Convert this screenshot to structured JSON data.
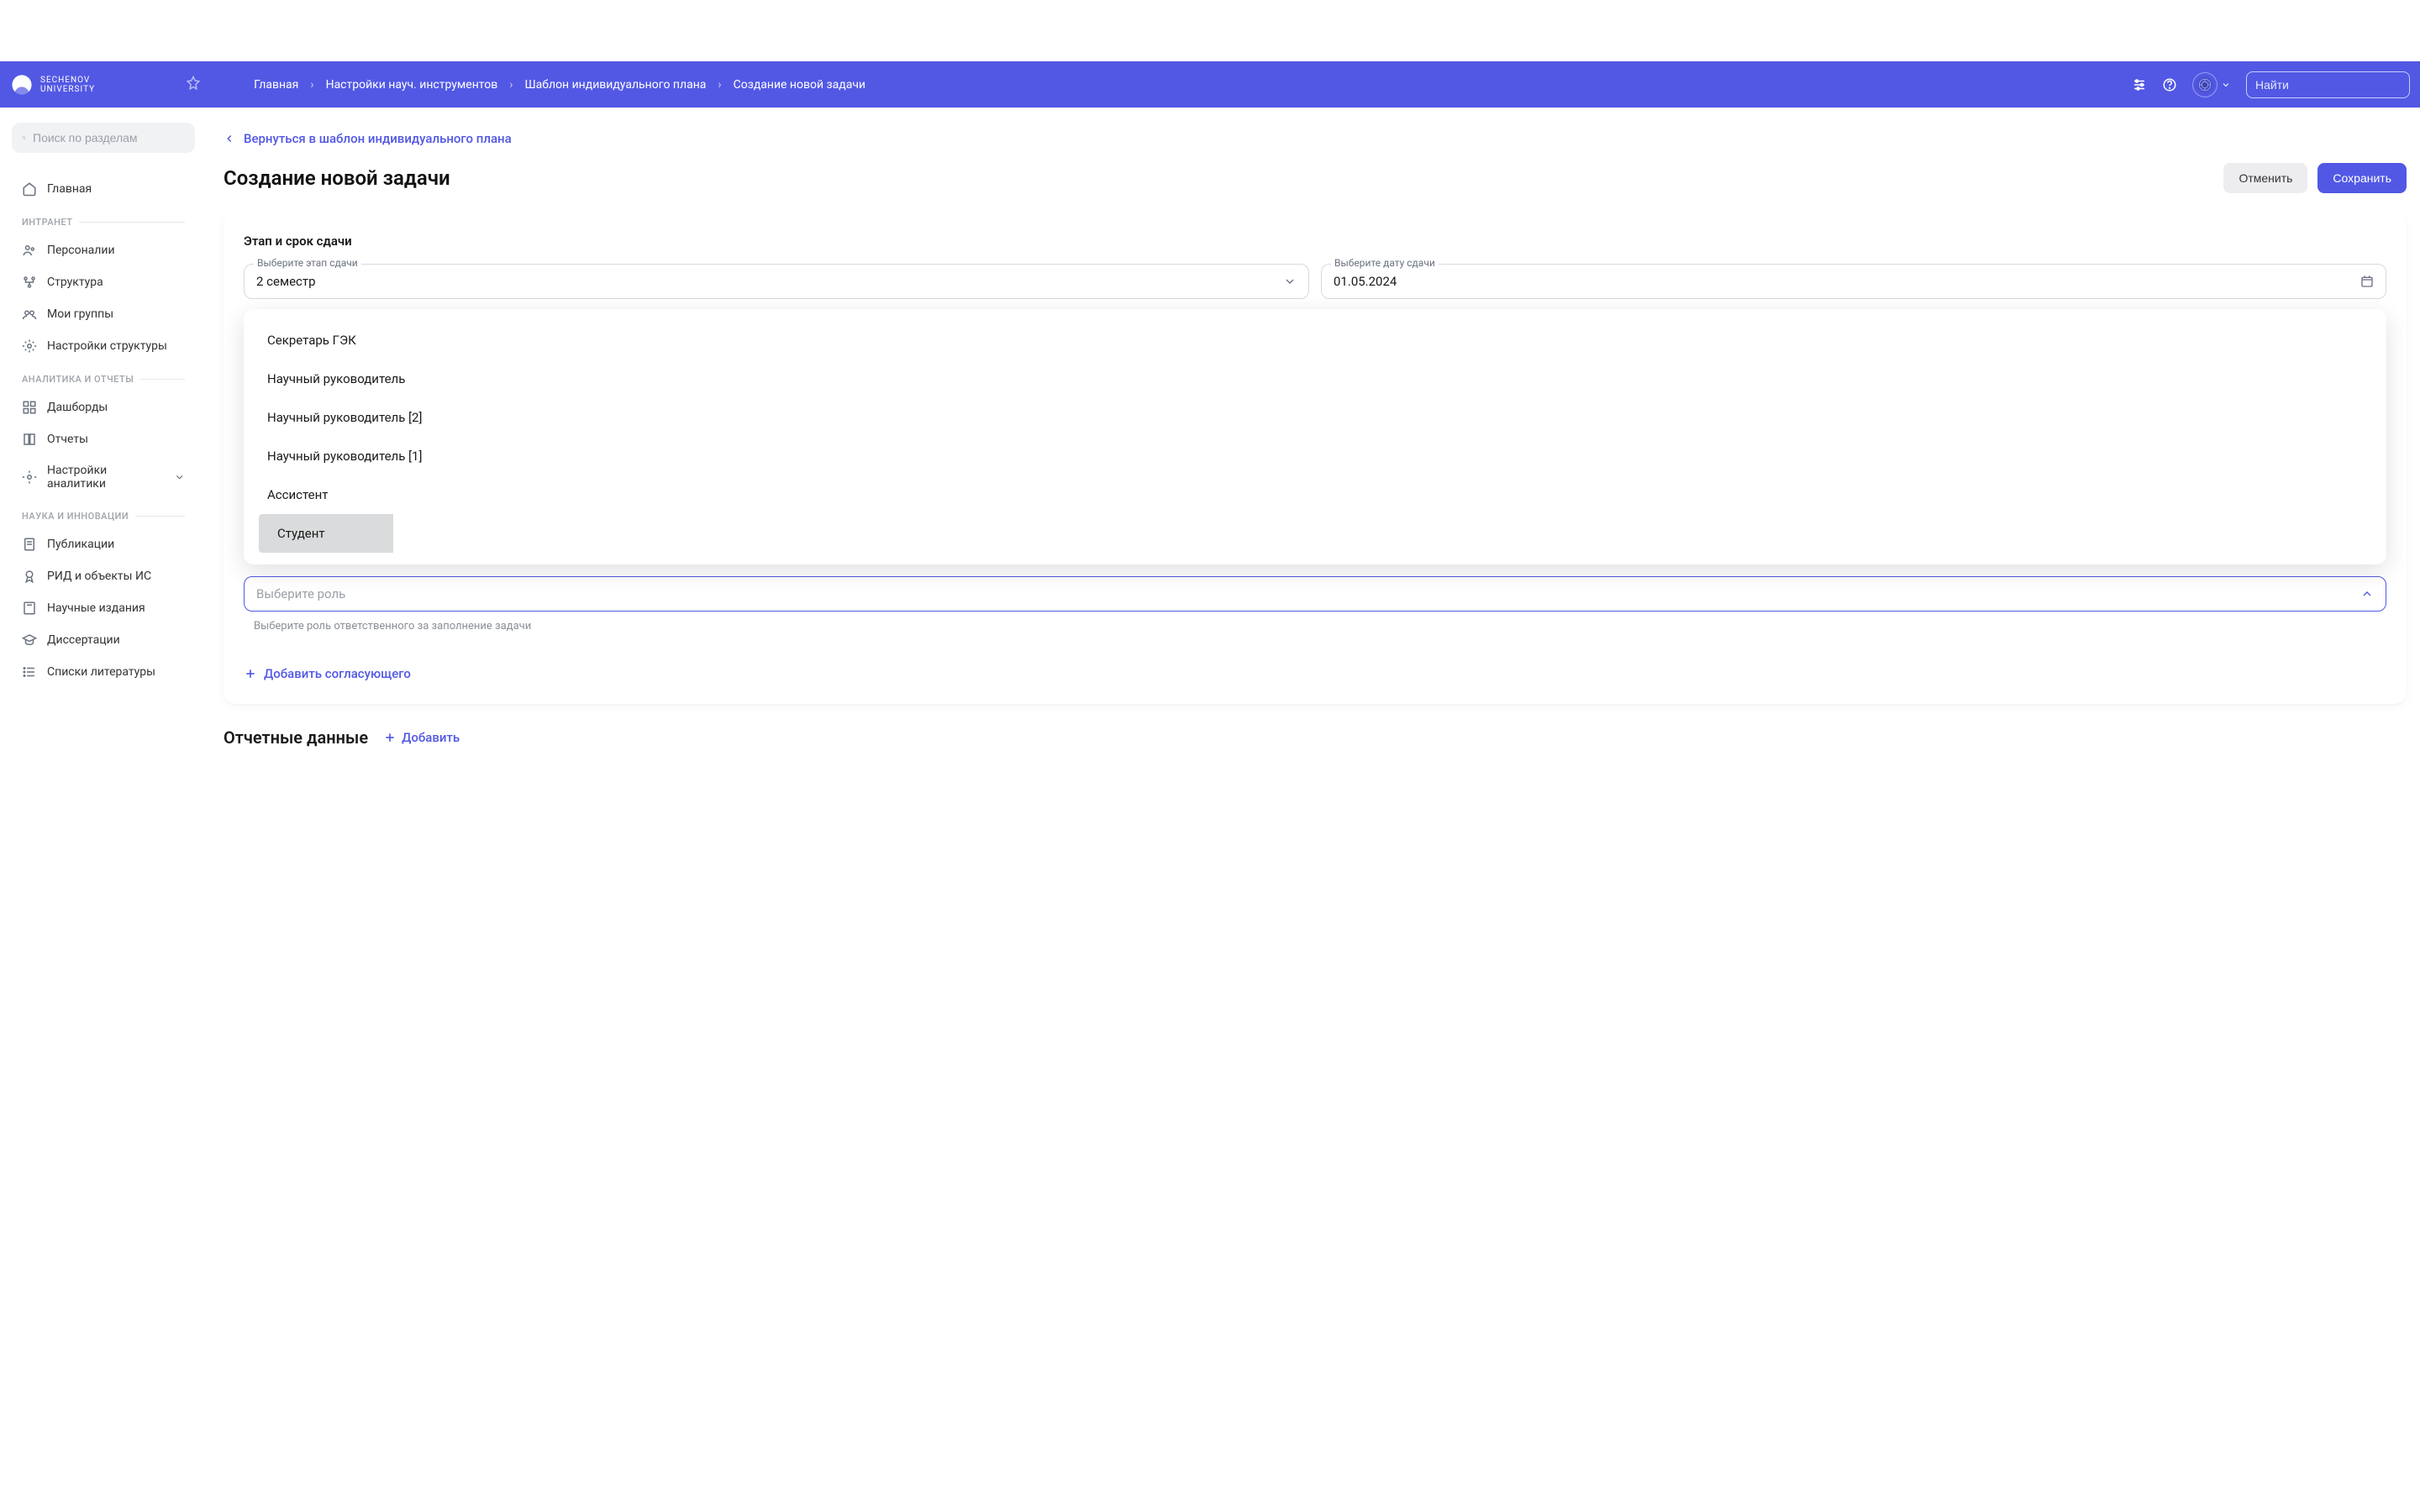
{
  "brand": {
    "line1": "SECHENOV",
    "line2": "UNIVERSITY"
  },
  "header": {
    "breadcrumb": [
      "Главная",
      "Настройки науч. инструментов",
      "Шаблон индивидуального плана",
      "Создание новой задачи"
    ],
    "search_placeholder": "Найти"
  },
  "sidebar": {
    "search_placeholder": "Поиск по разделам",
    "home": "Главная",
    "section_intranet": "ИНТРАНЕТ",
    "intranet": [
      "Персоналии",
      "Структура",
      "Мои группы",
      "Настройки структуры"
    ],
    "section_analytics": "АНАЛИТИКА И ОТЧЕТЫ",
    "analytics": [
      "Дашборды",
      "Отчеты",
      "Настройки аналитики"
    ],
    "section_science": "НАУКА И ИННОВАЦИИ",
    "science": [
      "Публикации",
      "РИД и объекты ИС",
      "Научные издания",
      "Диссертации",
      "Списки литературы"
    ]
  },
  "main": {
    "back": "Вернуться в шаблон индивидуального плана",
    "title": "Создание новой задачи",
    "cancel": "Отменить",
    "save": "Сохранить",
    "stage_section": "Этап и срок сдачи",
    "stage_label": "Выберите этап сдачи",
    "stage_value": "2 семестр",
    "date_label": "Выберите дату сдачи",
    "date_value": "01.05.2024",
    "role_placeholder": "Выберите роль",
    "role_helper": "Выберите роль ответственного за заполнение задачи",
    "role_options": [
      "Секретарь ГЭК",
      "Научный руководитель",
      "Научный руководитель [2]",
      "Научный руководитель [1]",
      "Ассистент",
      "Студент"
    ],
    "add_approver": "Добавить согласующего",
    "report_section": "Отчетные данные",
    "add_button": "Добавить"
  }
}
